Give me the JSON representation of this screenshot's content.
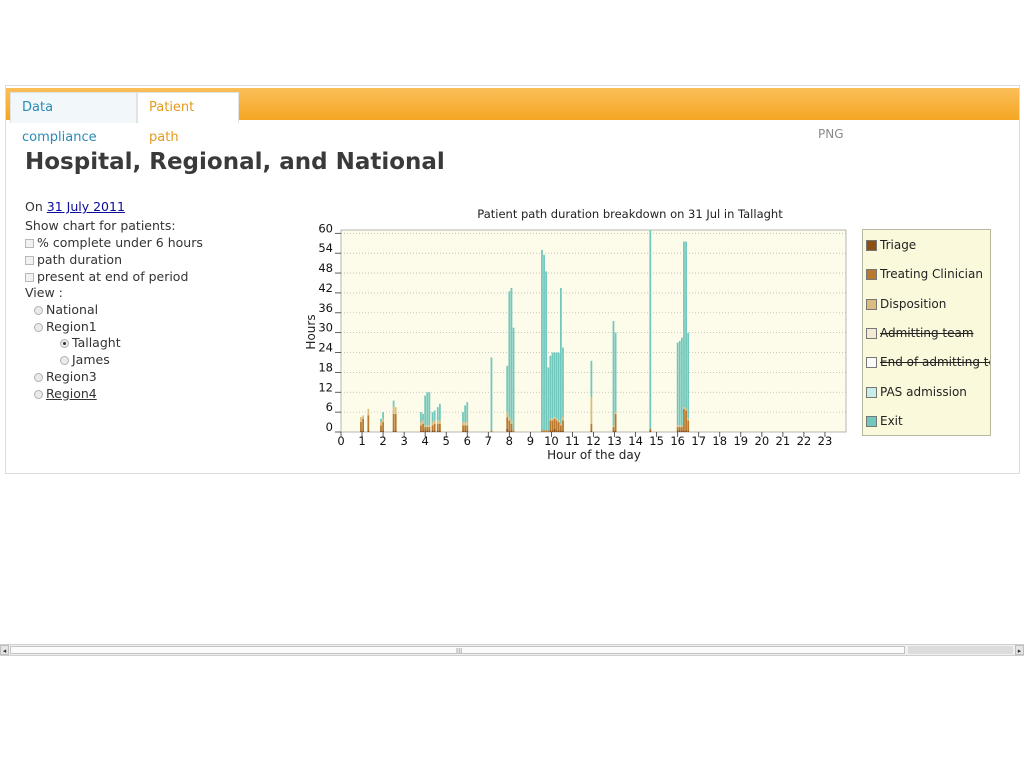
{
  "tabs": [
    {
      "label": "Data compliance"
    },
    {
      "label": "Patient path"
    }
  ],
  "page_title": "Hospital, Regional, and National",
  "controls": {
    "on_label": "On",
    "date_link": "31 July 2011",
    "show_chart_label": "Show chart for patients:",
    "options": [
      {
        "label": "% complete under 6 hours",
        "checked": false
      },
      {
        "label": "path duration",
        "checked": false
      },
      {
        "label": "present at end of period",
        "checked": false
      }
    ],
    "view_label": "View :",
    "view_tree": {
      "national": "National",
      "region1": "Region1",
      "tallaght": "Tallaght",
      "james": "James",
      "region3": "Region3",
      "region4": "Region4"
    },
    "selected_view": "Tallaght"
  },
  "png_link": "PNG",
  "legend": {
    "items": [
      {
        "label": "Triage",
        "color": "#8b4f12",
        "strike": false
      },
      {
        "label": "Treating Clinician",
        "color": "#b8782d",
        "strike": false
      },
      {
        "label": "Disposition",
        "color": "#dcbc7e",
        "strike": false
      },
      {
        "label": "Admitting team",
        "color": "#f4ead6",
        "strike": true
      },
      {
        "label": "End of admitting team",
        "color": "#fbfbfb",
        "strike": true
      },
      {
        "label": "PAS admission",
        "color": "#c8ece8",
        "strike": false
      },
      {
        "label": "Exit",
        "color": "#72c8bc",
        "strike": false
      }
    ]
  },
  "scrollbar": {
    "left_arrow": "◂",
    "right_arrow": "▸",
    "grip": "III"
  },
  "chart_data": {
    "type": "bar",
    "stacked": true,
    "title": "Patient path duration breakdown on 31 Jul in Tallaght",
    "xlabel": "Hour of the day",
    "ylabel": "Hours",
    "xlim": [
      0,
      24
    ],
    "ylim": [
      0,
      61
    ],
    "y_ticks": [
      0,
      6,
      12,
      18,
      24,
      30,
      36,
      42,
      48,
      54,
      60
    ],
    "x_ticks": [
      0,
      1,
      2,
      3,
      4,
      5,
      6,
      7,
      8,
      9,
      10,
      11,
      12,
      13,
      14,
      15,
      16,
      17,
      18,
      19,
      20,
      21,
      22,
      23
    ],
    "grid": true,
    "legend_position": "right",
    "series_order": [
      "Triage",
      "Treating Clinician",
      "Disposition",
      "Admitting team",
      "End of admitting team",
      "PAS admission",
      "Exit"
    ],
    "patients": [
      {
        "x": 0.95,
        "values": [
          0.5,
          2.5,
          1.5,
          0,
          0,
          0,
          0
        ]
      },
      {
        "x": 1.05,
        "values": [
          0.5,
          3.5,
          1,
          0,
          0,
          0,
          0
        ]
      },
      {
        "x": 1.3,
        "values": [
          0.5,
          4.5,
          2,
          0,
          0,
          0,
          0
        ]
      },
      {
        "x": 1.9,
        "values": [
          0.5,
          1.5,
          1,
          0,
          0,
          0,
          1
        ]
      },
      {
        "x": 2.0,
        "values": [
          0.5,
          2.5,
          1,
          0,
          0,
          0,
          2
        ]
      },
      {
        "x": 2.5,
        "values": [
          0.5,
          5,
          2,
          0,
          0,
          0,
          2
        ]
      },
      {
        "x": 2.6,
        "values": [
          0.5,
          5,
          2,
          0,
          0,
          0,
          0
        ]
      },
      {
        "x": 3.8,
        "values": [
          0.5,
          1.5,
          1,
          0,
          0,
          0,
          3
        ]
      },
      {
        "x": 3.9,
        "values": [
          0.5,
          2,
          1,
          0,
          0,
          0,
          2
        ]
      },
      {
        "x": 4.0,
        "values": [
          0.5,
          1,
          0.5,
          0,
          0,
          0,
          9
        ]
      },
      {
        "x": 4.1,
        "values": [
          0.5,
          1,
          0.5,
          0,
          0,
          0,
          10
        ]
      },
      {
        "x": 4.2,
        "values": [
          0.5,
          1,
          0.5,
          0,
          0,
          0,
          10
        ]
      },
      {
        "x": 4.35,
        "values": [
          0.5,
          1.5,
          1,
          0,
          0,
          0,
          3
        ]
      },
      {
        "x": 4.45,
        "values": [
          0.5,
          2,
          1,
          0,
          0,
          0,
          3
        ]
      },
      {
        "x": 4.6,
        "values": [
          0.5,
          2,
          1,
          0,
          0,
          0,
          4
        ]
      },
      {
        "x": 4.7,
        "values": [
          0.5,
          2,
          1,
          0,
          0,
          0,
          5
        ]
      },
      {
        "x": 5.8,
        "values": [
          0.5,
          1.5,
          1,
          0,
          0,
          0,
          3
        ]
      },
      {
        "x": 5.9,
        "values": [
          0.5,
          1.5,
          1,
          0,
          0,
          0,
          5
        ]
      },
      {
        "x": 6.0,
        "values": [
          0.5,
          1.5,
          1,
          0,
          0,
          0,
          6
        ]
      },
      {
        "x": 7.15,
        "values": [
          0,
          0.5,
          0,
          0,
          0,
          0,
          22
        ]
      },
      {
        "x": 7.9,
        "values": [
          1,
          3.5,
          1.5,
          0,
          0,
          0,
          14
        ]
      },
      {
        "x": 8.0,
        "values": [
          0.5,
          3,
          1,
          0,
          0,
          0,
          38
        ]
      },
      {
        "x": 8.1,
        "values": [
          0.5,
          2,
          1,
          0,
          0,
          0,
          40
        ]
      },
      {
        "x": 8.2,
        "values": [
          0,
          0.5,
          0,
          0,
          0,
          0,
          31
        ]
      },
      {
        "x": 9.55,
        "values": [
          0,
          0.5,
          0,
          0,
          0,
          0,
          54.5
        ]
      },
      {
        "x": 9.65,
        "values": [
          0,
          0.5,
          0,
          0,
          0,
          0,
          53
        ]
      },
      {
        "x": 9.75,
        "values": [
          0,
          0.5,
          0,
          0,
          0,
          0,
          48
        ]
      },
      {
        "x": 9.85,
        "values": [
          0,
          0.5,
          0,
          0,
          0,
          0,
          19
        ]
      },
      {
        "x": 9.95,
        "values": [
          0.5,
          3,
          0.5,
          0,
          0,
          0,
          19
        ]
      },
      {
        "x": 10.05,
        "values": [
          0.5,
          3,
          0.5,
          0,
          0,
          0,
          20
        ]
      },
      {
        "x": 10.15,
        "values": [
          1,
          3,
          0.5,
          0,
          0,
          0,
          19.5
        ]
      },
      {
        "x": 10.25,
        "values": [
          0.5,
          3,
          0.5,
          0,
          0,
          0,
          20
        ]
      },
      {
        "x": 10.35,
        "values": [
          0.5,
          2.5,
          0.5,
          0,
          0,
          0,
          20.5
        ]
      },
      {
        "x": 10.45,
        "values": [
          0.5,
          1.5,
          0.5,
          0,
          0,
          0,
          41
        ]
      },
      {
        "x": 10.55,
        "values": [
          0.5,
          3,
          1,
          0,
          0,
          0,
          21
        ]
      },
      {
        "x": 11.9,
        "values": [
          0.5,
          2,
          8,
          0,
          0,
          0,
          11
        ]
      },
      {
        "x": 12.95,
        "values": [
          0.5,
          1,
          0.5,
          0,
          0,
          0,
          31.5
        ]
      },
      {
        "x": 13.05,
        "values": [
          0.5,
          5,
          0.5,
          0,
          0,
          0,
          24
        ]
      },
      {
        "x": 14.7,
        "values": [
          0.5,
          0.5,
          0,
          0,
          0,
          0,
          60
        ]
      },
      {
        "x": 16.0,
        "values": [
          0.5,
          1,
          0.5,
          0,
          0,
          0,
          25
        ]
      },
      {
        "x": 16.1,
        "values": [
          0.5,
          1,
          0.5,
          0,
          0,
          0,
          25.5
        ]
      },
      {
        "x": 16.2,
        "values": [
          0.5,
          1,
          0.5,
          0,
          0,
          0,
          26.5
        ]
      },
      {
        "x": 16.3,
        "values": [
          0.5,
          6.5,
          0.5,
          0,
          0,
          0,
          50
        ]
      },
      {
        "x": 16.4,
        "values": [
          0.5,
          6,
          0.5,
          0,
          0,
          0,
          50.5
        ]
      },
      {
        "x": 16.5,
        "values": [
          0.5,
          3,
          0.5,
          0,
          0,
          0,
          26
        ]
      }
    ]
  }
}
